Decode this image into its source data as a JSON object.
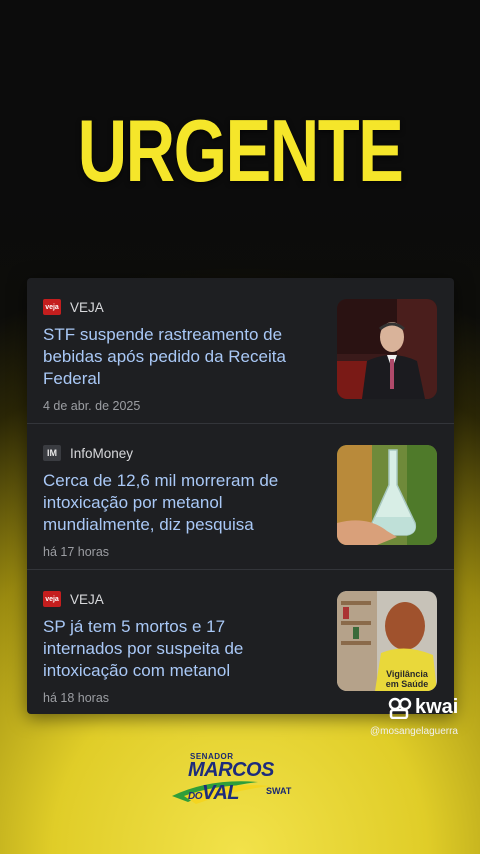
{
  "headline": "URGENTE",
  "articles": [
    {
      "source": "VEJA",
      "logo_text": "veja",
      "title": "STF suspende rastreamento de bebidas após pedido da Receita Federal",
      "time": "4 de abr. de 2025"
    },
    {
      "source": "InfoMoney",
      "logo_text": "IM",
      "title": "Cerca de 12,6 mil morreram de intoxicação por metanol mundialmente, diz pesquisa",
      "time": "há 17 horas"
    },
    {
      "source": "VEJA",
      "logo_text": "veja",
      "title": "SP já tem 5 mortos e 17 internados por suspeita de intoxicação com metanol",
      "time": "há 18 horas",
      "thumb_text": "Vigilância em Saúde"
    }
  ],
  "watermark": {
    "app": "kwai",
    "handle": "@mosangelaguerra"
  },
  "brand": {
    "top": "SENADOR",
    "main1": "MARCOS",
    "main2": "DO",
    "main3": "VAL",
    "sub": "SWAT"
  },
  "colors": {
    "headline": "#f5e62a",
    "title_link": "#a9c8f6",
    "card_bg": "#1e1f22"
  }
}
